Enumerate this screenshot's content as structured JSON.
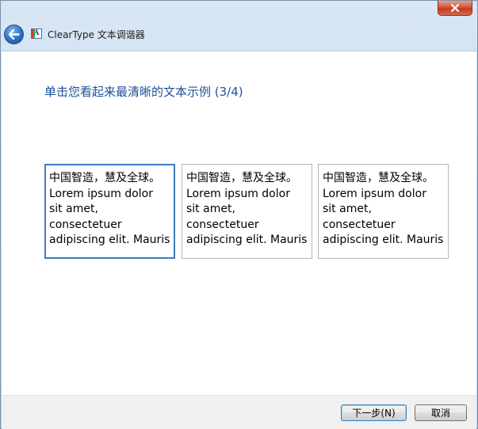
{
  "window": {
    "title": "ClearType 文本调谐器",
    "close_icon": "close-icon",
    "back_icon": "back-arrow-icon",
    "app_icon": "cleartype-icon",
    "app_icon_glyph": "A"
  },
  "main": {
    "heading": "单击您看起来最清晰的文本示例 (3/4)",
    "samples": [
      {
        "lines": [
          "中国智造，慧及全球。",
          "Lorem ipsum dolor",
          "sit amet,",
          "consectetuer",
          "adipiscing elit. Mauris"
        ],
        "selected": true
      },
      {
        "lines": [
          "中国智造，慧及全球。",
          "Lorem ipsum dolor",
          "sit amet,",
          "consectetuer",
          "adipiscing elit. Mauris"
        ],
        "selected": false
      },
      {
        "lines": [
          "中国智造，慧及全球。",
          "Lorem ipsum dolor",
          "sit amet,",
          "consectetuer",
          "adipiscing elit. Mauris"
        ],
        "selected": false
      }
    ]
  },
  "footer": {
    "next_label": "下一步(N)",
    "cancel_label": "取消"
  },
  "colors": {
    "heading": "#1e4f9a",
    "selected_border": "#3e7bbf",
    "close_button": "#c23b1f"
  }
}
